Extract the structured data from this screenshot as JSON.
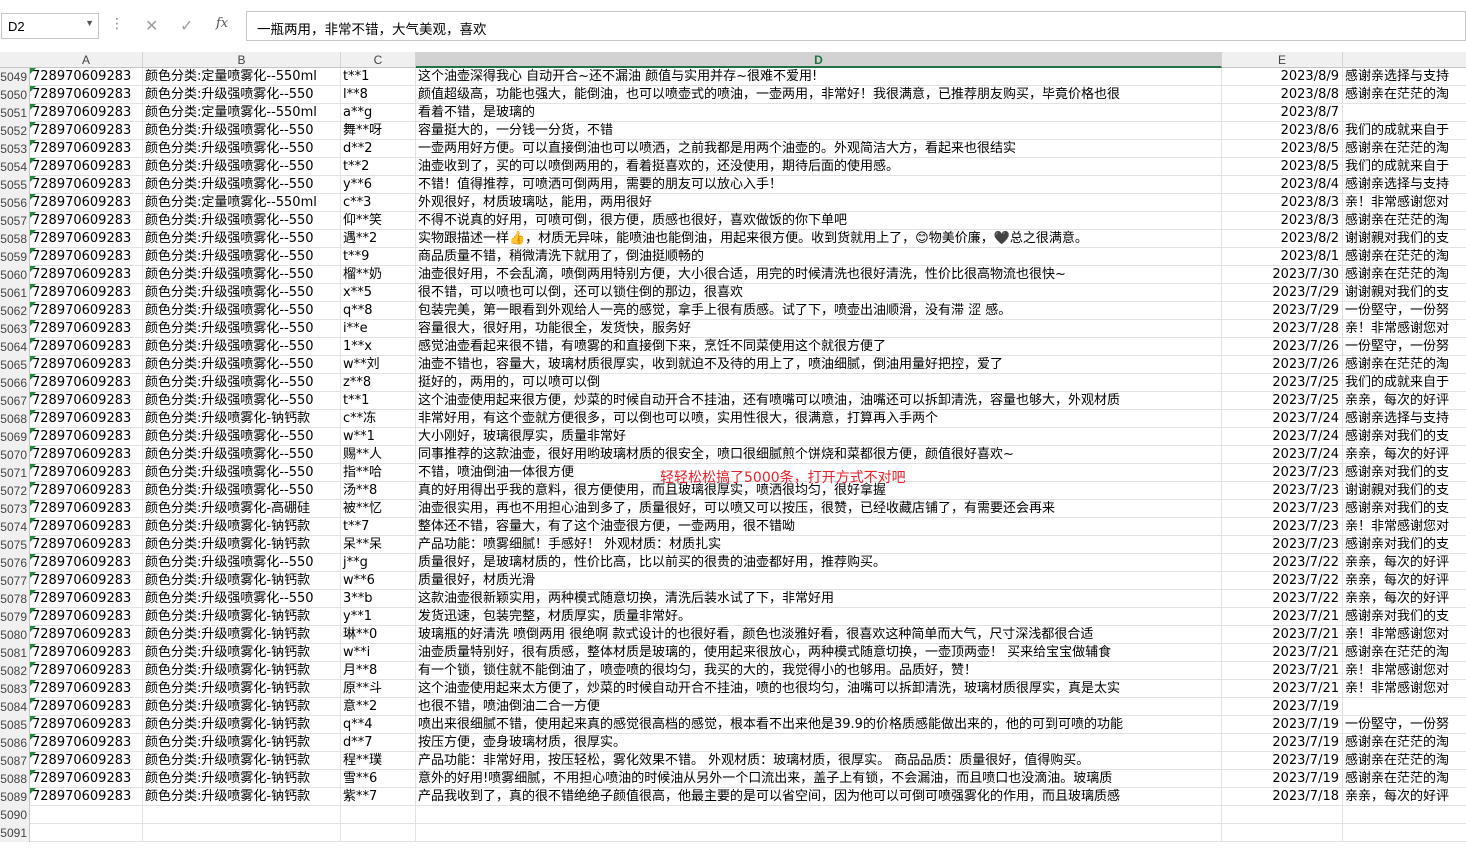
{
  "formula_bar": {
    "name_box": "D2",
    "formula": "一瓶两用，非常不错，大气美观，喜欢"
  },
  "columns": [
    "A",
    "B",
    "C",
    "D",
    "E"
  ],
  "overlay_text": "轻轻松松搞了5000条，打开方式不对吧",
  "rows": [
    {
      "n": "5049",
      "a": "728970609283",
      "b": "颜色分类:定量喷雾化--550ml",
      "c": "t**1",
      "d": "这个油壶深得我心 自动开合~还不漏油 颜值与实用并存~很难不爱用!",
      "e": "2023/8/9",
      "f": "感谢亲选择与支持"
    },
    {
      "n": "5050",
      "a": "728970609283",
      "b": "颜色分类:升级强喷雾化--550",
      "c": "l**8",
      "d": "颜值超级高，功能也强大，能倒油，也可以喷壶式的喷油，一壶两用，非常好！我很满意，已推荐朋友购买，毕竟价格也很",
      "e": "2023/8/8",
      "f": "感谢亲在茫茫的淘"
    },
    {
      "n": "5051",
      "a": "728970609283",
      "b": "颜色分类:定量喷雾化--550ml",
      "c": "a**g",
      "d": "看着不错，是玻璃的",
      "e": "2023/8/7",
      "f": ""
    },
    {
      "n": "5052",
      "a": "728970609283",
      "b": "颜色分类:升级强喷雾化--550",
      "c": "舞**呀",
      "d": "容量挺大的，一分钱一分货，不错",
      "e": "2023/8/6",
      "f": "我们的成就来自于"
    },
    {
      "n": "5053",
      "a": "728970609283",
      "b": "颜色分类:升级强喷雾化--550",
      "c": "d**2",
      "d": "一壶两用好方便。可以直接倒油也可以喷洒，之前我都是用两个油壶的。外观简洁大方，看起来也很结实",
      "e": "2023/8/5",
      "f": "感谢亲在茫茫的淘"
    },
    {
      "n": "5054",
      "a": "728970609283",
      "b": "颜色分类:升级强喷雾化--550",
      "c": "t**2",
      "d": "油壶收到了，买的可以喷倒两用的，看着挺喜欢的，还没使用，期待后面的使用感。",
      "e": "2023/8/5",
      "f": "我们的成就来自于"
    },
    {
      "n": "5055",
      "a": "728970609283",
      "b": "颜色分类:升级强喷雾化--550",
      "c": "y**6",
      "d": "不错！值得推荐，可喷洒可倒两用，需要的朋友可以放心入手！",
      "e": "2023/8/4",
      "f": "感谢亲选择与支持"
    },
    {
      "n": "5056",
      "a": "728970609283",
      "b": "颜色分类:定量喷雾化--550ml",
      "c": "c**3",
      "d": "外观很好，材质玻璃哒，能用，两用很好",
      "e": "2023/8/3",
      "f": "亲！非常感谢您对"
    },
    {
      "n": "5057",
      "a": "728970609283",
      "b": "颜色分类:升级强喷雾化--550",
      "c": "仰**笑",
      "d": "不得不说真的好用，可喷可倒，很方便，质感也很好，喜欢做饭的你下单吧",
      "e": "2023/8/3",
      "f": "感谢亲在茫茫的淘"
    },
    {
      "n": "5058",
      "a": "728970609283",
      "b": "颜色分类:升级强喷雾化--550",
      "c": "遇**2",
      "d": "实物跟描述一样👍，材质无异味，能喷油也能倒油，用起来很方便。收到货就用上了，😊物美价廉，🖤总之很满意。",
      "e": "2023/8/2",
      "f": "谢谢親对我们的支"
    },
    {
      "n": "5059",
      "a": "728970609283",
      "b": "颜色分类:升级强喷雾化--550",
      "c": "t**9",
      "d": "商品质量不错，稍微清洗下就用了，倒油挺顺畅的",
      "e": "2023/8/1",
      "f": "感谢亲在茫茫的淘"
    },
    {
      "n": "5060",
      "a": "728970609283",
      "b": "颜色分类:升级强喷雾化--550",
      "c": "榴**奶",
      "d": "油壶很好用，不会乱滴，喷倒两用特别方便，大小很合适，用完的时候清洗也很好清洗，性价比很高物流也很快~",
      "e": "2023/7/30",
      "f": "感谢亲在茫茫的淘"
    },
    {
      "n": "5061",
      "a": "728970609283",
      "b": "颜色分类:升级强喷雾化--550",
      "c": "x**5",
      "d": "很不错，可以喷也可以倒，还可以锁住倒的那边，很喜欢",
      "e": "2023/7/29",
      "f": "谢谢親对我们的支"
    },
    {
      "n": "5062",
      "a": "728970609283",
      "b": "颜色分类:升级强喷雾化--550",
      "c": "q**8",
      "d": "包装完美，第一眼看到外观给人一亮的感觉，拿手上很有质感。试了下，喷壶出油顺滑，没有滞 涩 感。",
      "e": "2023/7/29",
      "f": "一份堅守，一份努"
    },
    {
      "n": "5063",
      "a": "728970609283",
      "b": "颜色分类:升级强喷雾化--550",
      "c": "i**e",
      "d": "容量很大，很好用，功能很全，发货快，服务好",
      "e": "2023/7/28",
      "f": "亲！非常感谢您对"
    },
    {
      "n": "5064",
      "a": "728970609283",
      "b": "颜色分类:升级强喷雾化--550",
      "c": "1**x",
      "d": "感觉油壶看起来很不错，有喷雾的和直接倒下来，烹饪不同菜使用这个就很方便了",
      "e": "2023/7/26",
      "f": "一份堅守，一份努"
    },
    {
      "n": "5065",
      "a": "728970609283",
      "b": "颜色分类:升级强喷雾化--550",
      "c": "w**刘",
      "d": "油壶不错也，容量大，玻璃材质很厚实，收到就迫不及待的用上了，喷油细腻，倒油用量好把控，爱了",
      "e": "2023/7/26",
      "f": "感谢亲在茫茫的淘"
    },
    {
      "n": "5066",
      "a": "728970609283",
      "b": "颜色分类:升级强喷雾化--550",
      "c": "z**8",
      "d": "挺好的，两用的，可以喷可以倒",
      "e": "2023/7/25",
      "f": "我们的成就来自于"
    },
    {
      "n": "5067",
      "a": "728970609283",
      "b": "颜色分类:升级强喷雾化--550",
      "c": "t**1",
      "d": "这个油壶使用起来很方便，炒菜的时候自动开合不挂油，还有喷嘴可以喷油，油嘴还可以拆卸清洗，容量也够大，外观材质",
      "e": "2023/7/25",
      "f": "亲亲，每次的好评"
    },
    {
      "n": "5068",
      "a": "728970609283",
      "b": "颜色分类:升级喷雾化-钠钙款",
      "c": "c**冻",
      "d": "非常好用，有这个壶就方便很多，可以倒也可以喷，实用性很大，很满意，打算再入手两个",
      "e": "2023/7/24",
      "f": "感谢亲选择与支持"
    },
    {
      "n": "5069",
      "a": "728970609283",
      "b": "颜色分类:升级强喷雾化--550",
      "c": "w**1",
      "d": "大小刚好，玻璃很厚实，质量非常好",
      "e": "2023/7/24",
      "f": "感谢亲对我们的支"
    },
    {
      "n": "5070",
      "a": "728970609283",
      "b": "颜色分类:升级强喷雾化--550",
      "c": "赐**人",
      "d": "同事推荐的这款油壶，很好用哟玻璃材质的很安全，喷口很细腻煎个饼烧和菜都很方便，颜值很好喜欢~",
      "e": "2023/7/24",
      "f": "亲亲，每次的好评"
    },
    {
      "n": "5071",
      "a": "728970609283",
      "b": "颜色分类:升级强喷雾化--550",
      "c": "指**哈",
      "d": "不错，喷油倒油一体很方便",
      "e": "2023/7/23",
      "f": "感谢亲对我们的支"
    },
    {
      "n": "5072",
      "a": "728970609283",
      "b": "颜色分类:升级强喷雾化--550",
      "c": "汤**8",
      "d": "真的好用得出乎我的意料，很方便使用，而且玻璃很厚实，喷洒很均匀，很好拿握",
      "e": "2023/7/23",
      "f": "谢谢親对我们的支"
    },
    {
      "n": "5073",
      "a": "728970609283",
      "b": "颜色分类:升级喷雾化-高硼硅",
      "c": "被**忆",
      "d": "油壶很实用，再也不用担心油到多了，质量很好，可以喷又可以按压，很赞，已经收藏店铺了，有需要还会再来",
      "e": "2023/7/23",
      "f": "感谢亲对我们的支"
    },
    {
      "n": "5074",
      "a": "728970609283",
      "b": "颜色分类:升级喷雾化-钠钙款",
      "c": "t**7",
      "d": "整体还不错，容量大，有了这个油壶很方便，一壶两用，很不错呦",
      "e": "2023/7/23",
      "f": "亲！非常感谢您对"
    },
    {
      "n": "5075",
      "a": "728970609283",
      "b": "颜色分类:升级喷雾化-钠钙款",
      "c": "呆**呆",
      "d": "产品功能：喷雾细腻！手感好！ 外观材质：材质扎实",
      "e": "2023/7/23",
      "f": "感谢亲对我们的支"
    },
    {
      "n": "5076",
      "a": "728970609283",
      "b": "颜色分类:升级强喷雾化--550",
      "c": "j**g",
      "d": "质量很好，是玻璃材质的，性价比高，比以前买的很贵的油壶都好用，推荐购买。",
      "e": "2023/7/22",
      "f": "亲亲，每次的好评"
    },
    {
      "n": "5077",
      "a": "728970609283",
      "b": "颜色分类:升级喷雾化-钠钙款",
      "c": "w**6",
      "d": "质量很好，材质光滑",
      "e": "2023/7/22",
      "f": "亲亲，每次的好评"
    },
    {
      "n": "5078",
      "a": "728970609283",
      "b": "颜色分类:升级强喷雾化--550",
      "c": "3**b",
      "d": "这款油壶很新颖实用，两种模式随意切换，清洗后装水试了下，非常好用",
      "e": "2023/7/22",
      "f": "亲亲，每次的好评"
    },
    {
      "n": "5079",
      "a": "728970609283",
      "b": "颜色分类:升级喷雾化-钠钙款",
      "c": "y**1",
      "d": "发货迅速，包装完整，材质厚实，质量非常好。",
      "e": "2023/7/21",
      "f": "感谢亲对我们的支"
    },
    {
      "n": "5080",
      "a": "728970609283",
      "b": "颜色分类:升级喷雾化-钠钙款",
      "c": "琳**0",
      "d": " 玻璃瓶的好清洗  喷倒两用 很绝啊 款式设计的也很好看，颜色也淡雅好看，很喜欢这种简单而大气，尺寸深浅都很合适",
      "e": "2023/7/21",
      "f": "亲！非常感谢您对"
    },
    {
      "n": "5081",
      "a": "728970609283",
      "b": "颜色分类:升级喷雾化-钠钙款",
      "c": "w**i",
      "d": "油壶质量特别好，很有质感，整体材质是玻璃的，使用起来很放心，两种模式随意切换，一壶顶两壶！ 买来给宝宝做辅食",
      "e": "2023/7/21",
      "f": "感谢亲在茫茫的淘"
    },
    {
      "n": "5082",
      "a": "728970609283",
      "b": "颜色分类:升级喷雾化-钠钙款",
      "c": "月**8",
      "d": "有一个锁，锁住就不能倒油了，喷壶喷的很均匀，我买的大的，我觉得小的也够用。品质好，赞！",
      "e": "2023/7/21",
      "f": "亲！非常感谢您对"
    },
    {
      "n": "5083",
      "a": "728970609283",
      "b": "颜色分类:升级喷雾化-钠钙款",
      "c": "原**斗",
      "d": "这个油壶使用起来太方便了，炒菜的时候自动开合不挂油，喷的也很均匀，油嘴可以拆卸清洗，玻璃材质很厚实，真是太实",
      "e": "2023/7/21",
      "f": "亲！非常感谢您对"
    },
    {
      "n": "5084",
      "a": "728970609283",
      "b": "颜色分类:升级喷雾化-钠钙款",
      "c": "意**2",
      "d": "也很不错，喷油倒油二合一方便",
      "e": "2023/7/19",
      "f": ""
    },
    {
      "n": "5085",
      "a": "728970609283",
      "b": "颜色分类:升级喷雾化-钠钙款",
      "c": "q**4",
      "d": "喷出来很细腻不错，使用起来真的感觉很高档的感觉，根本看不出来他是39.9的价格质感能做出来的，他的可到可喷的功能",
      "e": "2023/7/19",
      "f": "一份堅守，一份努"
    },
    {
      "n": "5086",
      "a": "728970609283",
      "b": "颜色分类:升级喷雾化-钠钙款",
      "c": "d**7",
      "d": "按压方便，壶身玻璃材质，很厚实。",
      "e": "2023/7/19",
      "f": "感谢亲在茫茫的淘"
    },
    {
      "n": "5087",
      "a": "728970609283",
      "b": "颜色分类:升级喷雾化-钠钙款",
      "c": "程**璞",
      "d": "产品功能：非常好用，按压轻松，雾化效果不错。  外观材质：玻璃材质，很厚实。  商品品质：质量很好，值得购买。",
      "e": "2023/7/19",
      "f": "感谢亲在茫茫的淘"
    },
    {
      "n": "5088",
      "a": "728970609283",
      "b": "颜色分类:升级喷雾化-钠钙款",
      "c": "雪**6",
      "d": "意外的好用!喷雾细腻，不用担心喷油的时候油从另外一个口流出来，盖子上有锁，不会漏油，而且喷口也没滴油。玻璃质",
      "e": "2023/7/19",
      "f": "感谢亲在茫茫的淘"
    },
    {
      "n": "5089",
      "a": "728970609283",
      "b": "颜色分类:升级喷雾化-钠钙款",
      "c": "紫**7",
      "d": "产品我收到了，真的很不错绝绝子颜值很高，他最主要的是可以省空间，因为他可以可倒可喷强雾化的作用，而且玻璃质感",
      "e": "2023/7/18",
      "f": "亲亲，每次的好评"
    },
    {
      "n": "5090",
      "a": "",
      "b": "",
      "c": "",
      "d": "",
      "e": "",
      "f": ""
    },
    {
      "n": "5091",
      "a": "",
      "b": "",
      "c": "",
      "d": "",
      "e": "",
      "f": ""
    }
  ]
}
